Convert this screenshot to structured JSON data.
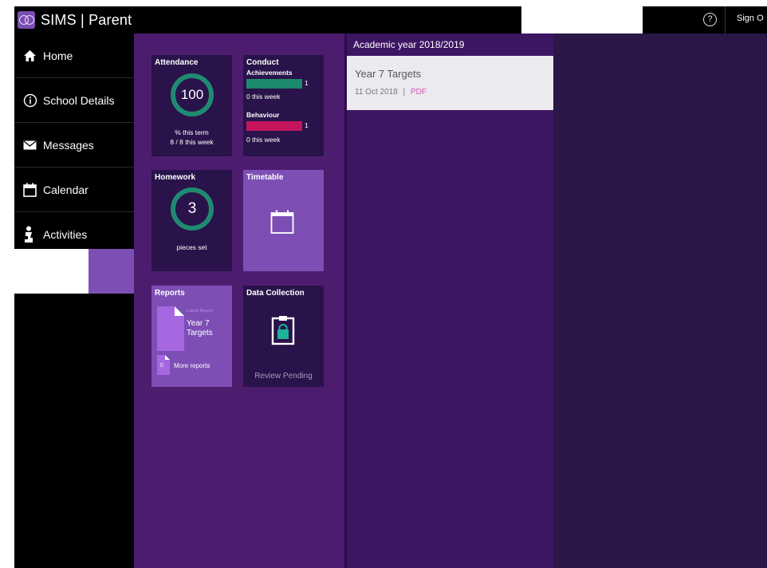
{
  "header": {
    "app_title": "SIMS | Parent",
    "help_label": "?",
    "sign_out_label": "Sign O"
  },
  "nav": {
    "items": [
      {
        "label": "Home",
        "icon": "home-icon"
      },
      {
        "label": "School Details",
        "icon": "info-icon"
      },
      {
        "label": "Messages",
        "icon": "envelope-icon"
      },
      {
        "label": "Calendar",
        "icon": "calendar-icon"
      },
      {
        "label": "Activities",
        "icon": "activities-icon"
      }
    ]
  },
  "tiles": {
    "attendance": {
      "title": "Attendance",
      "value": "100",
      "line1": "% this term",
      "line2": "8 / 8 this week"
    },
    "conduct": {
      "title": "Conduct",
      "achievements_label": "Achievements",
      "achievements_count": "1",
      "achievements_week": "0 this week",
      "behaviour_label": "Behaviour",
      "behaviour_count": "1",
      "behaviour_week": "0 this week"
    },
    "homework": {
      "title": "Homework",
      "value": "3",
      "caption": "pieces set"
    },
    "timetable": {
      "title": "Timetable"
    },
    "reports": {
      "title": "Reports",
      "latest_label": "Latest Report",
      "latest_name": "Year 7 Targets",
      "more_count": "0",
      "more_label": "More reports"
    },
    "data_collection": {
      "title": "Data Collection",
      "status": "Review Pending"
    }
  },
  "documents": {
    "section_title": "Academic year 2018/2019",
    "items": [
      {
        "title": "Year 7 Targets",
        "date": "11 Oct 2018",
        "separator": "|",
        "type": "PDF"
      }
    ]
  },
  "colors": {
    "accent_green": "#1f8a72",
    "achievement_bar": "#1b8a6d",
    "behaviour_bar": "#c4155c",
    "pdf_link": "#e04fb8",
    "tile_dark": "#29134a",
    "tile_light": "#7d4fb5"
  }
}
